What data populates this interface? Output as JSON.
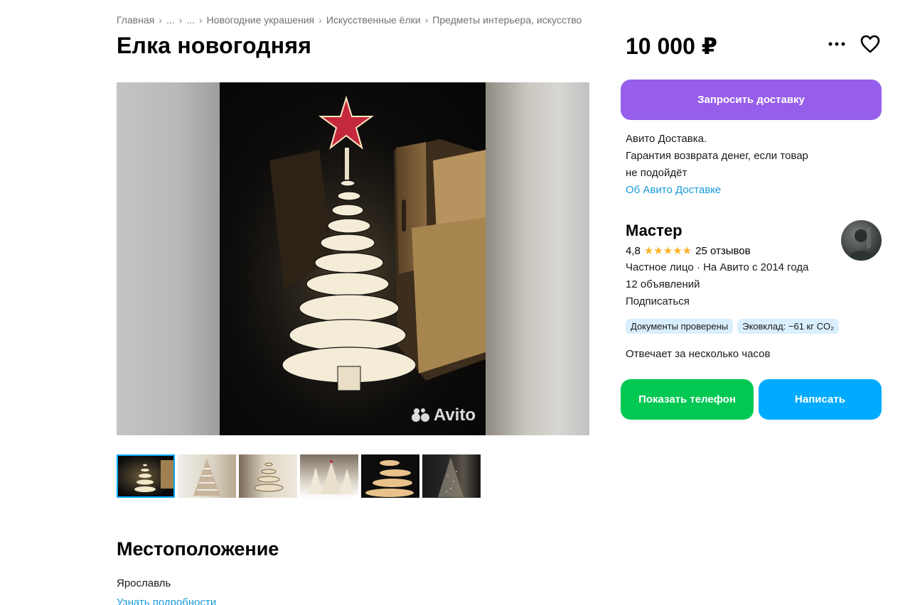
{
  "breadcrumb": [
    "Главная",
    "...",
    "...",
    "Новогодние украшения",
    "Искусственные ёлки",
    "Предметы интерьера, искусство"
  ],
  "listing": {
    "title": "Елка новогодняя",
    "price": "10 000 ₽"
  },
  "gallery": {
    "watermark": "Avito",
    "thumbnail_count": 6,
    "active_thumbnail": 1
  },
  "delivery": {
    "button_label": "Запросить доставку",
    "line1": "Авито Доставка.",
    "line2": "Гарантия возврата денег, если товар",
    "line3": "не подойдёт",
    "link": "Об Авито Доставке"
  },
  "seller": {
    "name": "Мастер",
    "rating": "4,8",
    "stars": "★★★★★",
    "reviews": "25 отзывов",
    "type_since": "Частное лицо · На Авито с 2014 года",
    "listings": "12 объявлений",
    "subscribe": "Подписаться",
    "badges": [
      "Документы проверены",
      "Эковклад: −61 кг CO₂"
    ],
    "response_time": "Отвечает за несколько часов"
  },
  "actions": {
    "phone": "Показать телефон",
    "message": "Написать"
  },
  "location": {
    "heading": "Местоположение",
    "city": "Ярославль",
    "more_link": "Узнать подробности"
  },
  "colors": {
    "delivery_button": "#965eeb",
    "phone_button": "#00c853",
    "message_button": "#00aaff",
    "link": "#1a9bdc",
    "stars": "#ffb021"
  }
}
